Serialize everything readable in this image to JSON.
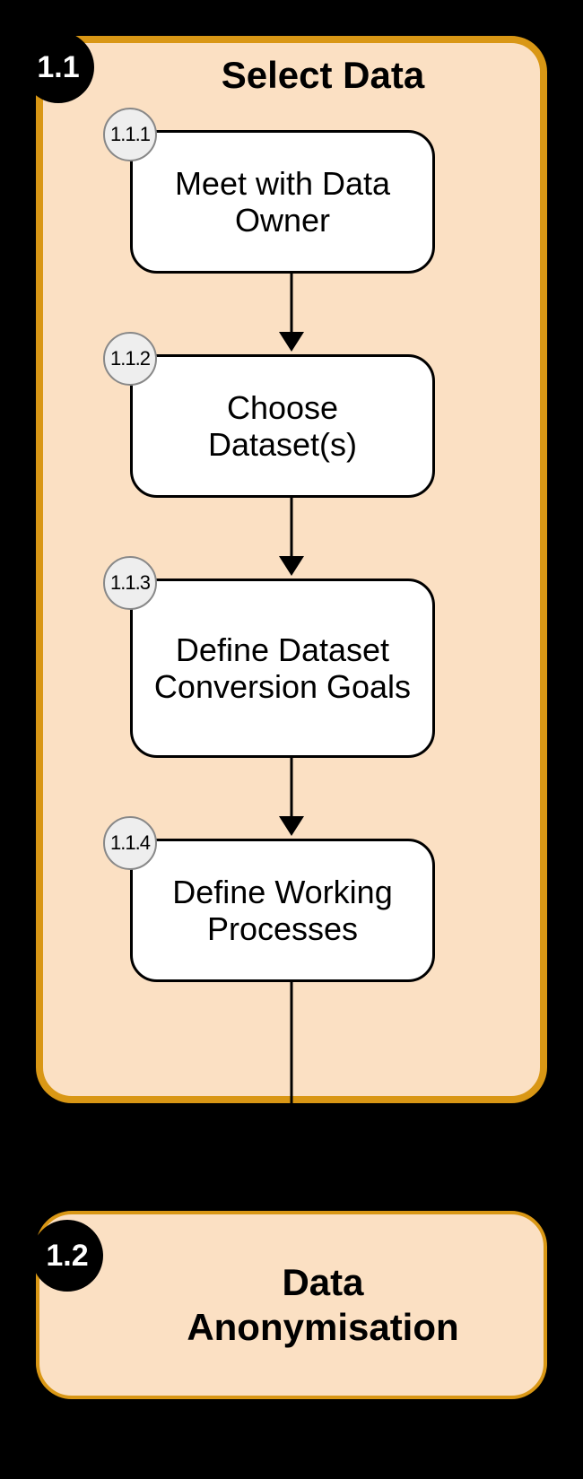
{
  "groups": [
    {
      "id": "1.1",
      "title": "Select Data",
      "steps": [
        {
          "id": "1.1.1",
          "label": "Meet with Data Owner"
        },
        {
          "id": "1.1.2",
          "label": "Choose Dataset(s)"
        },
        {
          "id": "1.1.3",
          "label": "Define Dataset Conversion Goals"
        },
        {
          "id": "1.1.4",
          "label": "Define Working Processes"
        }
      ]
    },
    {
      "id": "1.2",
      "title": "Data Anonymisation",
      "steps": []
    }
  ]
}
